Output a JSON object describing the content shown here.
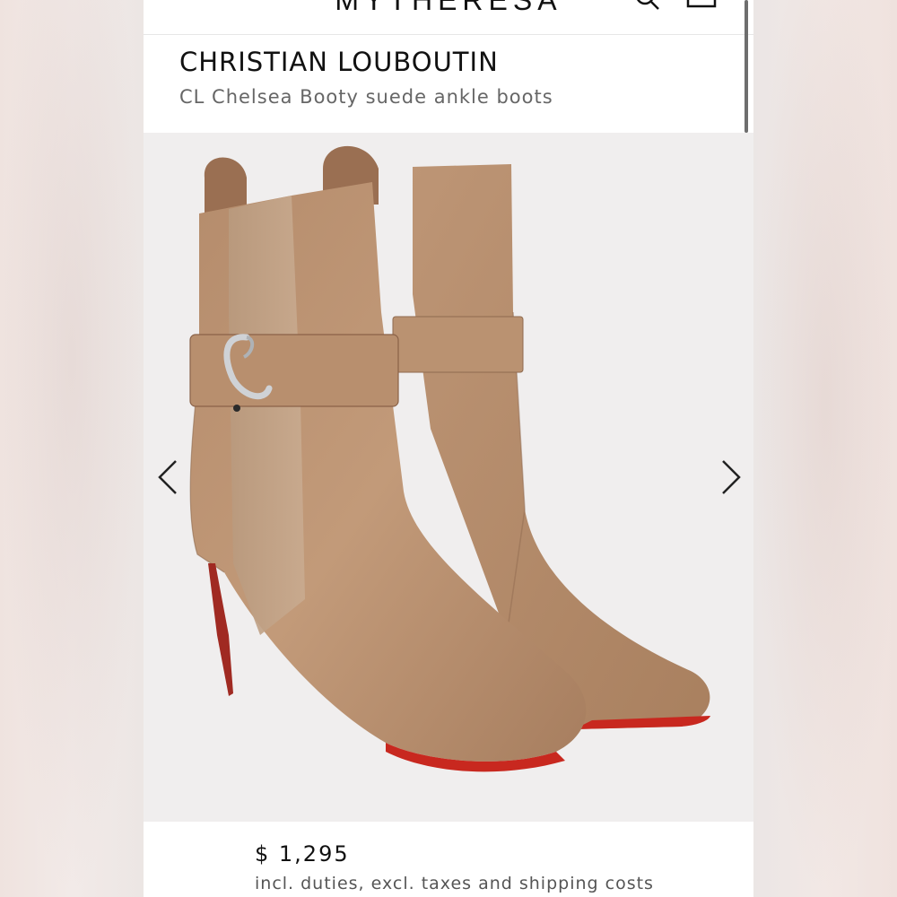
{
  "header": {
    "logo_text": "MYTHERESA",
    "menu_icon": "hamburger-menu-icon",
    "search_icon": "search-icon",
    "bag_icon": "shopping-bag-icon"
  },
  "product": {
    "brand": "CHRISTIAN LOUBOUTIN",
    "name": "CL Chelsea Booty suede ankle boots",
    "price": "$ 1,295",
    "price_note": "incl. duties, excl. taxes and shipping costs"
  },
  "gallery": {
    "prev_icon": "chevron-left-icon",
    "next_icon": "chevron-right-icon",
    "image_subject": "tan suede ankle boots with red soles",
    "colors": {
      "suede": "#b8906f",
      "sole": "#c8281f",
      "background": "#f0eeee"
    }
  }
}
